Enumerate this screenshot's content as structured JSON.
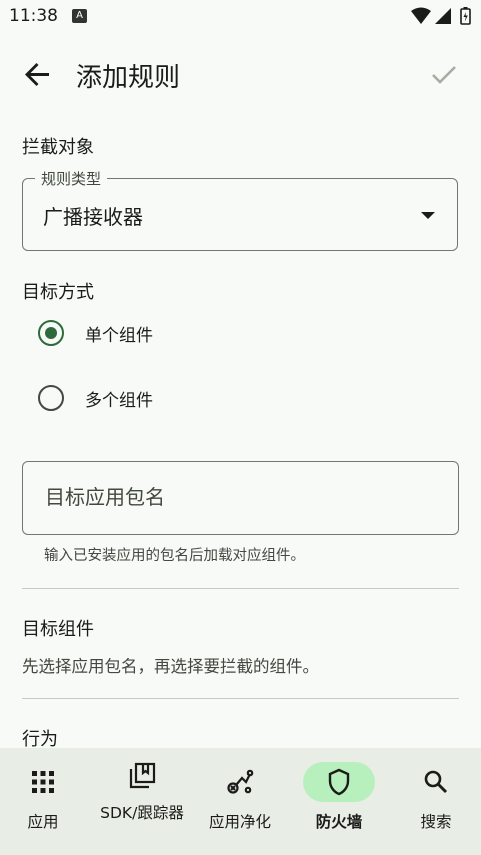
{
  "status_bar": {
    "time": "11:38",
    "notification_badge": "A"
  },
  "app_bar": {
    "title": "添加规则"
  },
  "intercept_section": {
    "label": "拦截对象",
    "rule_type": {
      "legend": "规则类型",
      "value": "广播接收器"
    }
  },
  "target_section": {
    "label": "目标方式",
    "options": [
      {
        "label": "单个组件",
        "selected": true
      },
      {
        "label": "多个组件",
        "selected": false
      }
    ],
    "package_input": {
      "placeholder": "目标应用包名",
      "value": ""
    },
    "helper": "输入已安装应用的包名后加载对应组件。"
  },
  "component_section": {
    "label": "目标组件",
    "text": "先选择应用包名，再选择要拦截的组件。"
  },
  "behavior_section": {
    "label": "行为"
  },
  "bottom_nav": {
    "items": [
      {
        "label": "应用",
        "icon": "apps-grid-icon",
        "active": false
      },
      {
        "label": "SDK/跟踪器",
        "icon": "library-books-icon",
        "active": false
      },
      {
        "label": "应用净化",
        "icon": "cleanup-icon",
        "active": false
      },
      {
        "label": "防火墙",
        "icon": "shield-icon",
        "active": true
      },
      {
        "label": "搜索",
        "icon": "search-icon",
        "active": false
      }
    ]
  },
  "colors": {
    "primary": "#2e6b3c",
    "active_indicator": "#b8f0bd",
    "background": "#f7faf6",
    "nav_background": "#e8ede5"
  }
}
